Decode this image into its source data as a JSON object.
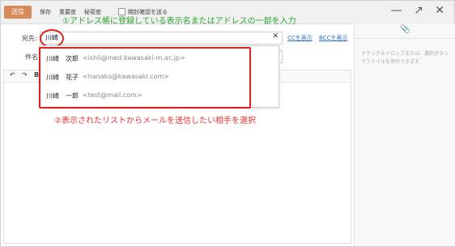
{
  "toolbar": {
    "send_label": "送信",
    "save_label": "保存",
    "priority_label": "重要度",
    "security_label": "秘密度",
    "read_receipt_label": "開封確認を送る"
  },
  "compose": {
    "to_label": "宛先:",
    "to_value": "川崎",
    "subject_label": "件名:",
    "cc_link": "CCを表示",
    "bcc_link": "BCCを表示"
  },
  "suggestions": [
    {
      "name": "川崎　次郎",
      "email": "<ishii@med.kawasaki-m.ac.jp>"
    },
    {
      "name": "川崎　花子",
      "email": "<hanako@kawasaki.com>"
    },
    {
      "name": "川崎　一郎",
      "email": "<test@mail.com>"
    }
  ],
  "attachments": {
    "drop_hint": "ドラッグ＆ドロップまたは、選択ボタンでファイルを添付できます"
  },
  "annotations": {
    "step1": "①アドレス帳に登録している表示名またはアドレスの一部を入力",
    "step2": "②表示されたリストからメールを送信したい相手を選択"
  },
  "colors": {
    "send_button": "#d98a5a",
    "annotation_green": "#2aa52a",
    "annotation_red": "#e83030",
    "link": "#2a6fc9"
  }
}
